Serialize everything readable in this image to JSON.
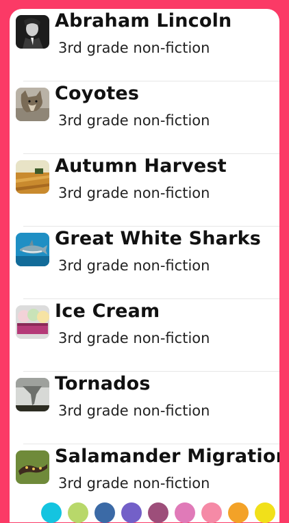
{
  "stories": [
    {
      "title": "Abraham Lincoln",
      "subtitle": "3rd grade non-fiction",
      "thumbnail": "lincoln-portrait"
    },
    {
      "title": "Coyotes",
      "subtitle": "3rd grade non-fiction",
      "thumbnail": "coyote-photo"
    },
    {
      "title": "Autumn Harvest",
      "subtitle": "3rd grade non-fiction",
      "thumbnail": "harvest-field-photo"
    },
    {
      "title": "Great White Sharks",
      "subtitle": "3rd grade non-fiction",
      "thumbnail": "shark-photo"
    },
    {
      "title": "Ice Cream",
      "subtitle": "3rd grade non-fiction",
      "thumbnail": "ice-cream-photo"
    },
    {
      "title": "Tornados",
      "subtitle": "3rd grade non-fiction",
      "thumbnail": "tornado-photo"
    },
    {
      "title": "Salamander Migration",
      "subtitle": "3rd grade non-fiction",
      "thumbnail": "salamander-photo"
    }
  ],
  "theme_colors": [
    "#14c4e0",
    "#b8d86a",
    "#3b6aa6",
    "#7360c8",
    "#9d4e7a",
    "#e07ab8",
    "#f58aa6",
    "#f3a228",
    "#f1e01a"
  ],
  "accent": "#fb3a66"
}
